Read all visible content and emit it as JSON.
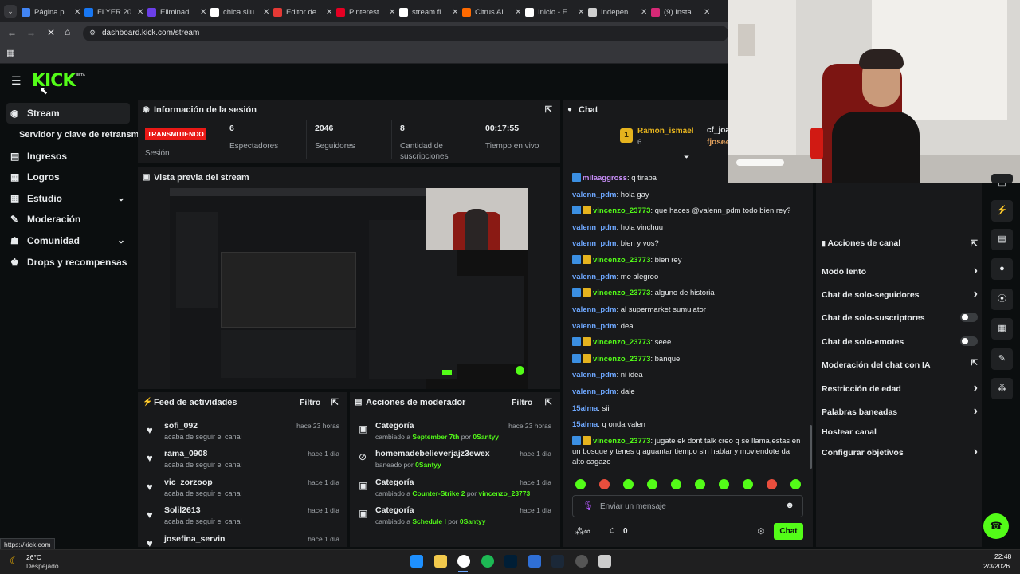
{
  "browser": {
    "tabs": [
      {
        "title": "Página p",
        "color": "#4285f4"
      },
      {
        "title": "FLYER 20",
        "color": "#1877f2"
      },
      {
        "title": "Eliminad",
        "color": "#6b3fe8"
      },
      {
        "title": "chica silu",
        "color": "#ffffff"
      },
      {
        "title": "Editor de",
        "color": "#e53935"
      },
      {
        "title": "Pinterest",
        "color": "#e60023"
      },
      {
        "title": "stream fi",
        "color": "#ffffff"
      },
      {
        "title": "Citrus AI",
        "color": "#ff6a00"
      },
      {
        "title": "Inicio - F",
        "color": "#ffffff"
      },
      {
        "title": "Indepen",
        "color": "#cfcfcf"
      },
      {
        "title": "(9) Insta",
        "color": "#d62976"
      }
    ],
    "url": "dashboard.kick.com/stream",
    "status_url": "https://kick.com"
  },
  "kick": {
    "logo": "KICK",
    "beta": "BETA"
  },
  "sidebar": {
    "items": [
      {
        "label": "Stream",
        "icon": "broadcast-icon"
      },
      {
        "label": "Servidor y clave de retransm",
        "icon": ""
      },
      {
        "label": "Ingresos",
        "icon": "bar-chart-icon"
      },
      {
        "label": "Logros",
        "icon": "trophy-icon"
      },
      {
        "label": "Estudio",
        "icon": "studio-icon"
      },
      {
        "label": "Moderación",
        "icon": "wrench-icon"
      },
      {
        "label": "Comunidad",
        "icon": "people-icon"
      },
      {
        "label": "Drops y recompensas",
        "icon": "gift-icon"
      }
    ]
  },
  "session": {
    "title": "Información de la sesión",
    "status": "TRANSMITIENDO",
    "status_label": "Sesión",
    "stats": [
      {
        "value": "6",
        "label": "Espectadores"
      },
      {
        "value": "2046",
        "label": "Seguidores"
      },
      {
        "value": "8",
        "label": "Cantidad de suscripciones"
      },
      {
        "value": "00:17:55",
        "label": "Tiempo en vivo"
      }
    ]
  },
  "preview": {
    "title": "Vista previa del stream"
  },
  "feed": {
    "title": "Feed de actividades",
    "filter": "Filtro",
    "rows": [
      {
        "name": "sofi_092",
        "sub": "acaba de seguir el canal",
        "time": "hace 23 horas"
      },
      {
        "name": "rama_0908",
        "sub": "acaba de seguir el canal",
        "time": "hace 1 día"
      },
      {
        "name": "vic_zorzoop",
        "sub": "acaba de seguir el canal",
        "time": "hace 1 día"
      },
      {
        "name": "Solil2613",
        "sub": "acaba de seguir el canal",
        "time": "hace 1 día"
      },
      {
        "name": "josefina_servin",
        "sub": "",
        "time": "hace 1 día"
      }
    ]
  },
  "modactions": {
    "title": "Acciones de moderador",
    "filter": "Filtro",
    "rows": [
      {
        "name": "Categoría",
        "pre": "cambiado a",
        "hl": "September 7th",
        "mid": "por",
        "who": "0Santyy",
        "time": "hace 23 horas"
      },
      {
        "name": "homemadebelieverjajz3ewex",
        "pre": "baneado por",
        "hl": "",
        "mid": "",
        "who": "0Santyy",
        "time": "hace 1 día"
      },
      {
        "name": "Categoría",
        "pre": "cambiado a",
        "hl": "Counter-Strike 2",
        "mid": "por",
        "who": "vincenzo_23773",
        "time": "hace 1 día"
      },
      {
        "name": "Categoría",
        "pre": "cambiado a",
        "hl": "Schedule I",
        "mid": "por",
        "who": "0Santyy",
        "time": "hace 1 día"
      }
    ]
  },
  "chat": {
    "title": "Chat",
    "pinned": {
      "rank": "1",
      "name": "Ramon_ismael",
      "count": "6",
      "name2": "cf_joa",
      "name3": "fjose4"
    },
    "messages": [
      {
        "user": "milaaggross",
        "text": "q tiraba",
        "color": "#c58cf5",
        "badges": 1
      },
      {
        "user": "valenn_pdm",
        "text": "hola gay",
        "color": "#6ea8ff",
        "badges": 0
      },
      {
        "user": "vincenzo_23773",
        "text": "que haces @valenn_pdm todo bien rey?",
        "color": "#53fc18",
        "badges": 2
      },
      {
        "user": "valenn_pdm",
        "text": "hola vinchuu",
        "color": "#6ea8ff",
        "badges": 0
      },
      {
        "user": "valenn_pdm",
        "text": "bien y vos?",
        "color": "#6ea8ff",
        "badges": 0
      },
      {
        "user": "vincenzo_23773",
        "text": "bien rey",
        "color": "#53fc18",
        "badges": 2
      },
      {
        "user": "valenn_pdm",
        "text": "me alegroo",
        "color": "#6ea8ff",
        "badges": 0
      },
      {
        "user": "vincenzo_23773",
        "text": "alguno de historia",
        "color": "#53fc18",
        "badges": 2
      },
      {
        "user": "valenn_pdm",
        "text": "al supermarket sumulator",
        "color": "#6ea8ff",
        "badges": 0
      },
      {
        "user": "valenn_pdm",
        "text": "dea",
        "color": "#6ea8ff",
        "badges": 0
      },
      {
        "user": "vincenzo_23773",
        "text": "seee",
        "color": "#53fc18",
        "badges": 2
      },
      {
        "user": "vincenzo_23773",
        "text": "banque",
        "color": "#53fc18",
        "badges": 2
      },
      {
        "user": "valenn_pdm",
        "text": "ni idea",
        "color": "#6ea8ff",
        "badges": 0
      },
      {
        "user": "valenn_pdm",
        "text": "dale",
        "color": "#6ea8ff",
        "badges": 0
      },
      {
        "user": "15alma",
        "text": "siii",
        "color": "#6ea8ff",
        "badges": 0
      },
      {
        "user": "15alma",
        "text": "q onda valen",
        "color": "#6ea8ff",
        "badges": 0
      },
      {
        "user": "vincenzo_23773",
        "text": "jugate ek dont talk creo q se llama,estas en un bosque y tenes q aguantar tiempo sin hablar y moviendote da alto cagazo",
        "color": "#53fc18",
        "badges": 2
      }
    ],
    "input_placeholder": "Enviar un mensaje",
    "count": "0",
    "send_label": "Chat"
  },
  "channel_actions": {
    "title": "Acciones de canal",
    "rows": [
      {
        "label": "Modo lento",
        "kind": "arrow"
      },
      {
        "label": "Chat de solo-seguidores",
        "kind": "arrow"
      },
      {
        "label": "Chat de solo-suscriptores",
        "kind": "toggle"
      },
      {
        "label": "Chat de solo-emotes",
        "kind": "toggle"
      },
      {
        "label": "Moderación del chat con IA",
        "kind": "ext"
      },
      {
        "label": "Restricción de edad",
        "kind": "arrow"
      },
      {
        "label": "Palabras baneadas",
        "kind": "arrow"
      },
      {
        "label": "Hostear canal",
        "kind": "none"
      },
      {
        "label": "Configurar objetivos",
        "kind": "arrow"
      }
    ]
  },
  "taskbar": {
    "weather_temp": "26°C",
    "weather_desc": "Despejado",
    "time": "22:48",
    "date": "2/3/2026"
  },
  "colors": {
    "accent": "#53fc18",
    "live": "#e91916",
    "panel": "#18191b",
    "bg": "#0b0e0f"
  }
}
